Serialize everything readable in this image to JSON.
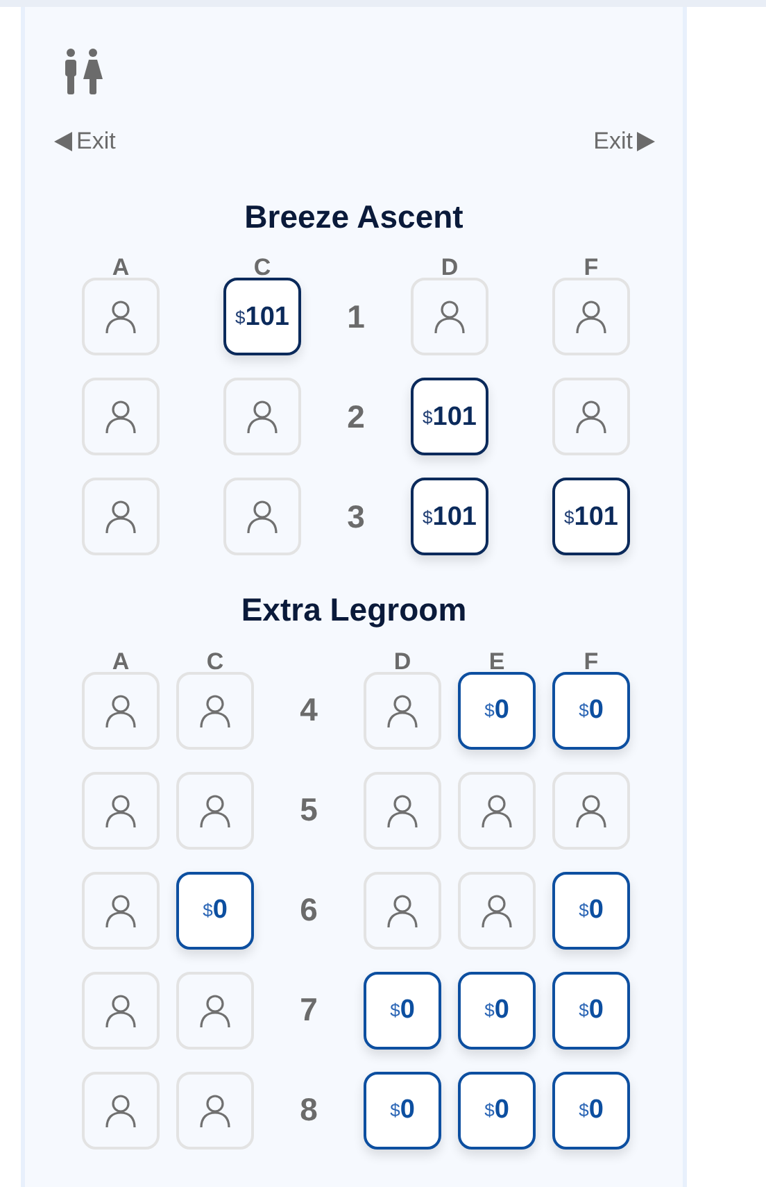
{
  "exits": {
    "left": "Exit",
    "right": "Exit"
  },
  "sections": [
    {
      "title": "Breeze Ascent",
      "kind": "premium",
      "left_columns": [
        "A",
        "C"
      ],
      "right_columns": [
        "D",
        "F"
      ],
      "rows": [
        {
          "number": "1",
          "seats": [
            {
              "kind": "occupied"
            },
            {
              "kind": "available",
              "currency": "$",
              "price": "101"
            },
            {
              "kind": "occupied"
            },
            {
              "kind": "occupied"
            }
          ]
        },
        {
          "number": "2",
          "seats": [
            {
              "kind": "occupied"
            },
            {
              "kind": "occupied"
            },
            {
              "kind": "available",
              "currency": "$",
              "price": "101"
            },
            {
              "kind": "occupied"
            }
          ]
        },
        {
          "number": "3",
          "seats": [
            {
              "kind": "occupied"
            },
            {
              "kind": "occupied"
            },
            {
              "kind": "available",
              "currency": "$",
              "price": "101"
            },
            {
              "kind": "available",
              "currency": "$",
              "price": "101"
            }
          ]
        }
      ]
    },
    {
      "title": "Extra Legroom",
      "kind": "extra",
      "left_columns": [
        "A",
        "C"
      ],
      "right_columns": [
        "D",
        "E",
        "F"
      ],
      "rows": [
        {
          "number": "4",
          "seats": [
            {
              "kind": "occupied"
            },
            {
              "kind": "occupied"
            },
            {
              "kind": "occupied"
            },
            {
              "kind": "available",
              "currency": "$",
              "price": "0"
            },
            {
              "kind": "available",
              "currency": "$",
              "price": "0"
            }
          ]
        },
        {
          "number": "5",
          "seats": [
            {
              "kind": "occupied"
            },
            {
              "kind": "occupied"
            },
            {
              "kind": "occupied"
            },
            {
              "kind": "occupied"
            },
            {
              "kind": "occupied"
            }
          ]
        },
        {
          "number": "6",
          "seats": [
            {
              "kind": "occupied"
            },
            {
              "kind": "available",
              "currency": "$",
              "price": "0"
            },
            {
              "kind": "occupied"
            },
            {
              "kind": "occupied"
            },
            {
              "kind": "available",
              "currency": "$",
              "price": "0"
            }
          ]
        },
        {
          "number": "7",
          "seats": [
            {
              "kind": "occupied"
            },
            {
              "kind": "occupied"
            },
            {
              "kind": "available",
              "currency": "$",
              "price": "0"
            },
            {
              "kind": "available",
              "currency": "$",
              "price": "0"
            },
            {
              "kind": "available",
              "currency": "$",
              "price": "0"
            }
          ]
        },
        {
          "number": "8",
          "seats": [
            {
              "kind": "occupied"
            },
            {
              "kind": "occupied"
            },
            {
              "kind": "available",
              "currency": "$",
              "price": "0"
            },
            {
              "kind": "available",
              "currency": "$",
              "price": "0"
            },
            {
              "kind": "available",
              "currency": "$",
              "price": "0"
            }
          ]
        }
      ]
    }
  ]
}
